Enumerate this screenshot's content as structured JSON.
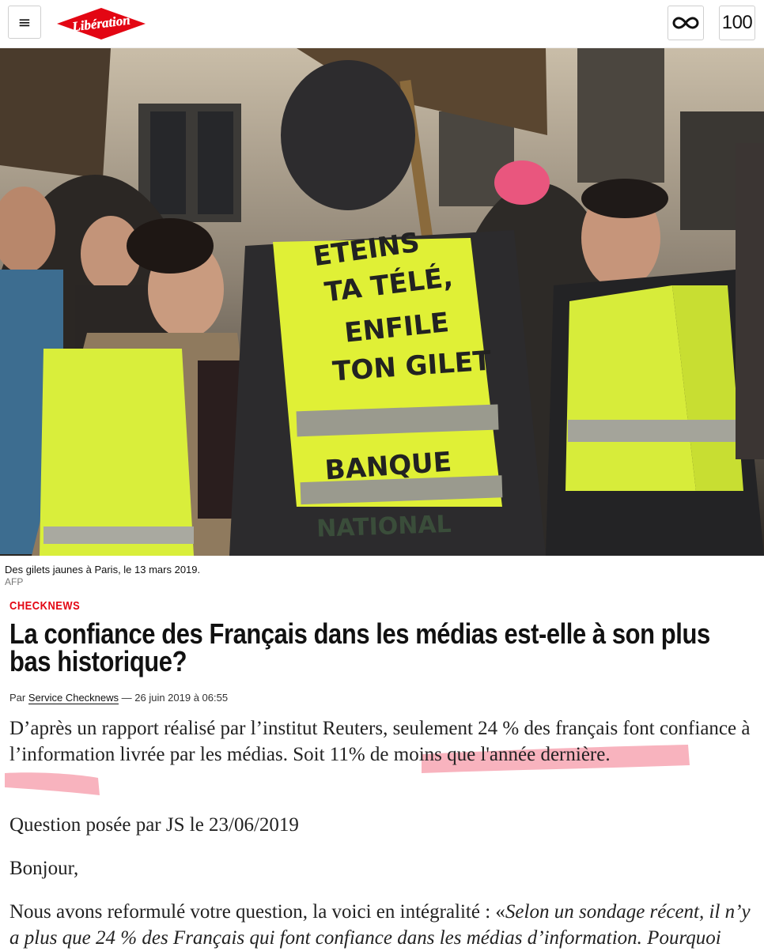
{
  "header": {
    "menu_glyph": "≡",
    "logo_text": "Libération",
    "infinite_icon": "infinity-icon",
    "counter": "100"
  },
  "photo": {
    "vest_line1": "ETEINS",
    "vest_line2": "TA TÉLÉ,",
    "vest_line3": "ENFILE",
    "vest_line4": "TON GILET",
    "vest_line5": "BANQUE",
    "vest_line6": "NATIONAL"
  },
  "caption": {
    "text": "Des gilets jaunes à Paris, le 13 mars 2019.",
    "credit": "AFP"
  },
  "article": {
    "rubric": "CHECKNEWS",
    "title": "La confiance des Français dans les médias est-elle à son plus bas historique?",
    "by_prefix": "Par",
    "author": "Service Checknews",
    "date": "— 26 juin 2019 à 06:55",
    "p1_a": "D’après un rapport réalisé par l’institut Reuters, seulement 24 % des français font confiance à l’information livrée par les médias. ",
    "p1_b": "Soit 11% de moins que l'année dernière.",
    "p2": "Question posée par JS le 23/06/2019",
    "p3": "Bonjour,",
    "p4_a": "Nous avons reformulé votre question, la voici en intégralité : «",
    "p4_b": "Selon un sondage récent, il n’y a plus que 24 % des Français qui font confiance dans les médias d’information. Pourquoi"
  },
  "colors": {
    "brand_red": "#e30613",
    "highlight": "#f28a9c"
  }
}
